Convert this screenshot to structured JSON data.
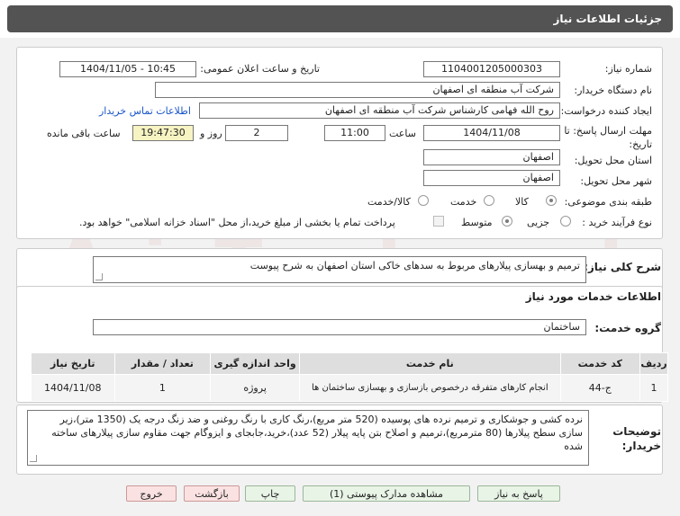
{
  "header": {
    "title": "جزئیات اطلاعات نیاز"
  },
  "form": {
    "need_number_label": "شماره نیاز:",
    "need_number": "1104001205000303",
    "announce_label": "تاریخ و ساعت اعلان عمومی:",
    "announce_value": "1404/11/05 - 10:45",
    "buyer_label": "نام دستگاه خریدار:",
    "buyer_value": "شرکت آب منطقه ای اصفهان",
    "creator_label": "ایجاد کننده درخواست:",
    "creator_value": "روح الله فهامی کارشناس شرکت آب منطقه ای اصفهان",
    "contact_link": "اطلاعات تماس خریدار",
    "deadline_label": "مهلت ارسال پاسخ: تا تاریخ:",
    "deadline_date": "1404/11/08",
    "time_label": "ساعت",
    "deadline_time": "11:00",
    "days_value": "2",
    "days_label": "روز و",
    "remaining_time": "19:47:30",
    "remaining_label": "ساعت باقی مانده",
    "province_label": "استان محل تحویل:",
    "province_value": "اصفهان",
    "city_label": "شهر محل تحویل:",
    "city_value": "اصفهان",
    "category_label": "طبقه بندی موضوعی:",
    "category_options": [
      "کالا",
      "خدمت",
      "کالا/خدمت"
    ],
    "process_label": "نوع فرآیند خرید :",
    "process_options": [
      "جزیی",
      "متوسط"
    ],
    "payment_note": "پرداخت تمام یا بخشی از مبلغ خرید،از محل \"اسناد خزانه اسلامی\" خواهد بود."
  },
  "description": {
    "label": "شرح کلی نیاز:",
    "value": "ترمیم و بهسازی پیلارهای مربوط به سدهای خاکی استان اصفهان  به شرح پیوست"
  },
  "services": {
    "section_title": "اطلاعات خدمات مورد نیاز",
    "group_label": "گروه خدمت:",
    "group_value": "ساختمان",
    "columns": [
      "ردیف",
      "کد خدمت",
      "نام خدمت",
      "واحد اندازه گیری",
      "تعداد / مقدار",
      "تاریخ نیاز"
    ],
    "rows": [
      [
        "1",
        "ج-44",
        "انجام کارهای متفرقه درخصوص بازسازی و بهسازی ساختمان ها",
        "پروژه",
        "1",
        "1404/11/08"
      ]
    ]
  },
  "buyer_notes": {
    "label": "توضیحات خریدار:",
    "value": "نرده کشی و جوشکاری و ترمیم  نرده های پوسیده (520 متر مربع)،رنگ کاری با رنگ روغنی و ضد زنگ درجه یک (1350 متر)،زیر سازی سطح پیلارها (80 مترمربع)،ترمیم و اصلاح بتن پایه پیلار (52 عدد)،خرید،جابجای و ایزوگام جهت مقاوم سازی پیلارهای ساخته شده"
  },
  "buttons": {
    "reply": "پاسخ به نیاز",
    "attachments": "مشاهده مدارک پیوستی (1)",
    "print": "چاپ",
    "back": "بازگشت",
    "exit": "خروج"
  },
  "watermark": "AriaTender.net"
}
